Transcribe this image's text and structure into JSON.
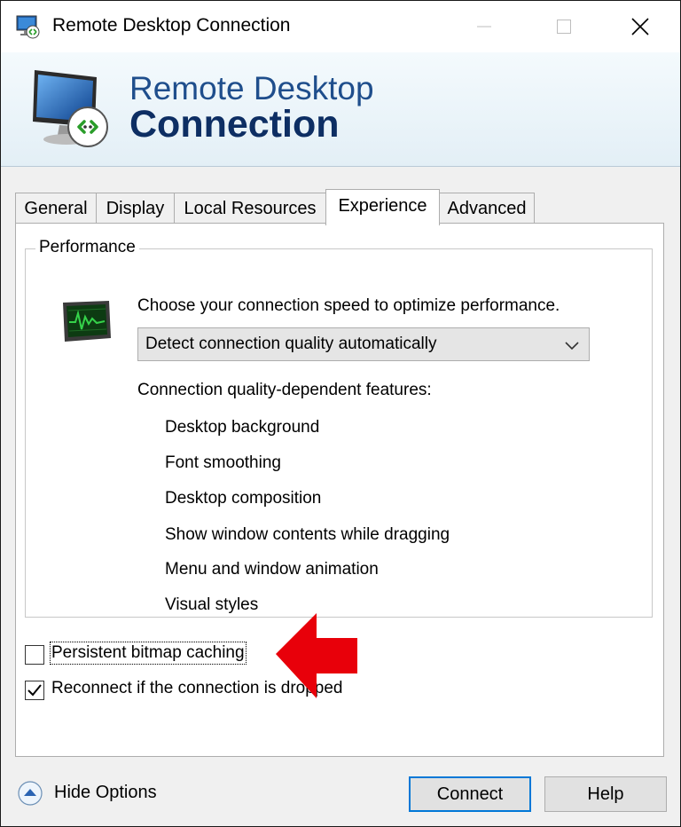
{
  "window": {
    "title": "Remote Desktop Connection",
    "icons": [
      "rdp-app-icon",
      "minimize-icon",
      "maximize-icon",
      "close-icon"
    ]
  },
  "banner": {
    "line1": "Remote Desktop",
    "line2": "Connection",
    "logo_icon": "rdp-monitor-logo-icon"
  },
  "tabs": [
    {
      "label": "General"
    },
    {
      "label": "Display"
    },
    {
      "label": "Local Resources"
    },
    {
      "label": "Experience",
      "selected": true
    },
    {
      "label": "Advanced"
    }
  ],
  "performance": {
    "group_label": "Performance",
    "speed_prompt": "Choose your connection speed to optimize performance.",
    "speed_select": {
      "selected": "Detect connection quality automatically"
    },
    "features_label": "Connection quality-dependent features:",
    "features": [
      "Desktop background",
      "Font smoothing",
      "Desktop composition",
      "Show window contents while dragging",
      "Menu and window animation",
      "Visual styles"
    ]
  },
  "options": [
    {
      "label": "Persistent bitmap caching",
      "checked": false,
      "focused": true
    },
    {
      "label": "Reconnect if the connection is dropped",
      "checked": true,
      "focused": false
    }
  ],
  "footer": {
    "hide_options": "Hide Options",
    "connect": "Connect",
    "help": "Help"
  },
  "colors": {
    "accent": "#0078d7",
    "banner_title": "#1f4e8c",
    "annotation_arrow": "#e8000a"
  }
}
